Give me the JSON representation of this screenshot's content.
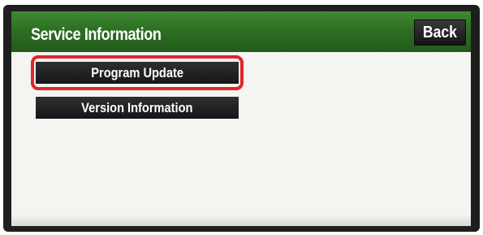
{
  "header": {
    "title": "Service Information",
    "back_label": "Back"
  },
  "menu": {
    "items": [
      {
        "label": "Program Update",
        "highlighted": true
      },
      {
        "label": "Version Information",
        "highlighted": false
      }
    ]
  },
  "colors": {
    "header_green": "#2d6f23",
    "button_dark": "#1f2022",
    "highlight_red": "#e0262a",
    "screen_bg": "#f4f4f1"
  }
}
